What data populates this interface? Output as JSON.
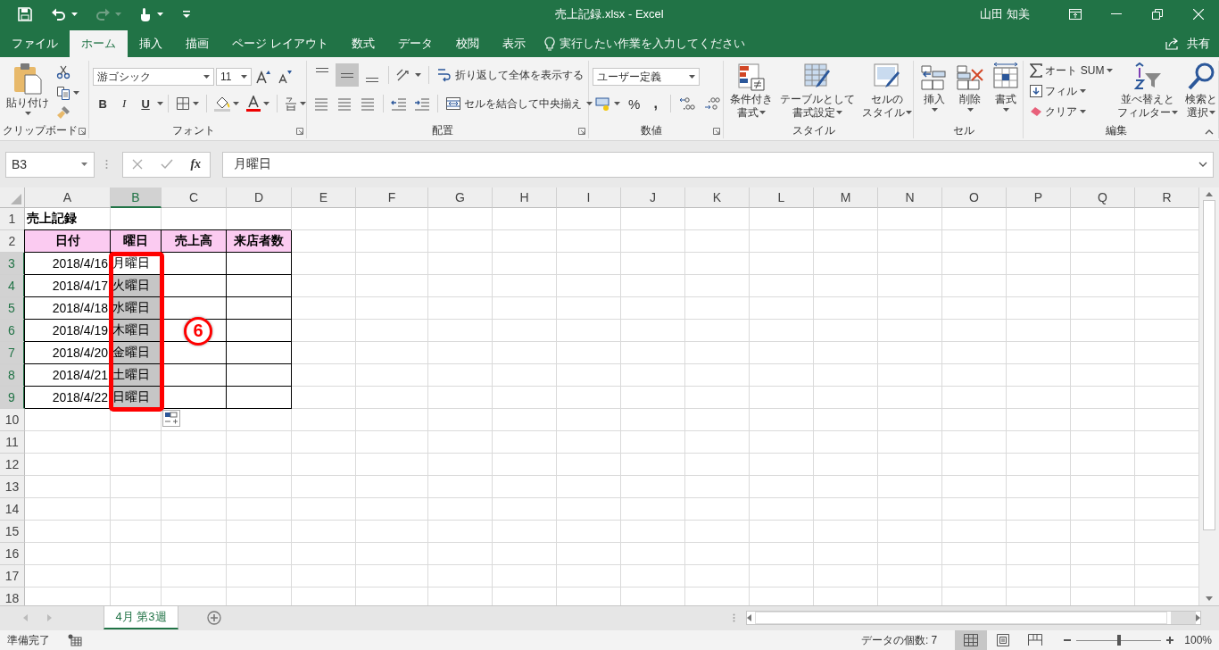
{
  "title_bar": {
    "title": "売上記録.xlsx  -  Excel",
    "user": "山田 知美",
    "redo_disabled": true
  },
  "ribbon_tabs": [
    {
      "label": "ファイル",
      "selected": false
    },
    {
      "label": "ホーム",
      "selected": true
    },
    {
      "label": "挿入",
      "selected": false
    },
    {
      "label": "描画",
      "selected": false
    },
    {
      "label": "ページ レイアウト",
      "selected": false
    },
    {
      "label": "数式",
      "selected": false
    },
    {
      "label": "データ",
      "selected": false
    },
    {
      "label": "校閲",
      "selected": false
    },
    {
      "label": "表示",
      "selected": false
    }
  ],
  "tell_me": {
    "placeholder": "実行したい作業を入力してください"
  },
  "share": "共有",
  "ribbon": {
    "groups": [
      {
        "kind": "clipboard",
        "label": "クリップボード",
        "paste": "貼り付け"
      },
      {
        "kind": "font",
        "label": "フォント",
        "font_name": "游ゴシック",
        "font_size": "11",
        "bold": "B",
        "italic": "I",
        "underline": "U"
      },
      {
        "kind": "alignment",
        "label": "配置",
        "vertical_align": [
          {
            "selected": false
          },
          {
            "selected": true
          },
          {
            "selected": false
          }
        ],
        "wrap_text": "折り返して全体を表示する",
        "merge_center": "セルを結合して中央揃え"
      },
      {
        "kind": "number",
        "label": "数値",
        "format": "ユーザー定義",
        "percent": "%",
        "comma": ","
      },
      {
        "kind": "styles",
        "label": "スタイル",
        "buttons": [
          {
            "lines": [
              "条件付き",
              "書式"
            ]
          },
          {
            "lines": [
              "テーブルとして",
              "書式設定"
            ]
          },
          {
            "lines": [
              "セルの",
              "スタイル"
            ]
          }
        ]
      },
      {
        "kind": "cells",
        "label": "セル",
        "buttons": [
          {
            "lines": [
              "挿入"
            ]
          },
          {
            "lines": [
              "削除"
            ]
          },
          {
            "lines": [
              "書式"
            ]
          }
        ]
      },
      {
        "kind": "editing",
        "label": "編集",
        "autosum": "オート SUM",
        "fill": "フィル",
        "clear": "クリア",
        "buttons": [
          {
            "lines": [
              "並べ替えと",
              "フィルター"
            ]
          },
          {
            "lines": [
              "検索と",
              "選択"
            ]
          }
        ]
      }
    ]
  },
  "formula_bar": {
    "name_box": "B3",
    "fx": "fx",
    "value": "月曜日"
  },
  "sheet": {
    "columns": [
      {
        "label": "A",
        "selected": false
      },
      {
        "label": "B",
        "selected": true
      },
      {
        "label": "C",
        "selected": false
      },
      {
        "label": "D",
        "selected": false
      },
      {
        "label": "E",
        "selected": false
      },
      {
        "label": "F",
        "selected": false
      },
      {
        "label": "G",
        "selected": false
      },
      {
        "label": "H",
        "selected": false
      },
      {
        "label": "I",
        "selected": false
      },
      {
        "label": "J",
        "selected": false
      },
      {
        "label": "K",
        "selected": false
      },
      {
        "label": "L",
        "selected": false
      },
      {
        "label": "M",
        "selected": false
      },
      {
        "label": "N",
        "selected": false
      },
      {
        "label": "O",
        "selected": false
      },
      {
        "label": "P",
        "selected": false
      },
      {
        "label": "Q",
        "selected": false
      },
      {
        "label": "R",
        "selected": false
      }
    ],
    "rows": [
      {
        "label": "1",
        "selected": false,
        "cells": [
          {
            "kind": "title",
            "text": "売上記録"
          }
        ]
      },
      {
        "label": "2",
        "selected": false,
        "cells": [
          {
            "kind": "header",
            "text": "日付"
          },
          {
            "kind": "header",
            "text": "曜日"
          },
          {
            "kind": "header",
            "text": "売上高"
          },
          {
            "kind": "header",
            "text": "来店者数"
          }
        ]
      },
      {
        "label": "3",
        "selected": true,
        "cells": [
          {
            "kind": "date",
            "text": "2018/4/16"
          },
          {
            "kind": "day",
            "text": "月曜日",
            "selected": true,
            "active": true
          },
          {
            "kind": "blank"
          },
          {
            "kind": "blank"
          }
        ]
      },
      {
        "label": "4",
        "selected": true,
        "cells": [
          {
            "kind": "date",
            "text": "2018/4/17"
          },
          {
            "kind": "day",
            "text": "火曜日",
            "selected": true,
            "active": false
          },
          {
            "kind": "blank"
          },
          {
            "kind": "blank"
          }
        ]
      },
      {
        "label": "5",
        "selected": true,
        "cells": [
          {
            "kind": "date",
            "text": "2018/4/18"
          },
          {
            "kind": "day",
            "text": "水曜日",
            "selected": true,
            "active": false
          },
          {
            "kind": "blank"
          },
          {
            "kind": "blank"
          }
        ]
      },
      {
        "label": "6",
        "selected": true,
        "cells": [
          {
            "kind": "date",
            "text": "2018/4/19"
          },
          {
            "kind": "day",
            "text": "木曜日",
            "selected": true,
            "active": false
          },
          {
            "kind": "blank"
          },
          {
            "kind": "blank"
          }
        ]
      },
      {
        "label": "7",
        "selected": true,
        "cells": [
          {
            "kind": "date",
            "text": "2018/4/20"
          },
          {
            "kind": "day",
            "text": "金曜日",
            "selected": true,
            "active": false
          },
          {
            "kind": "blank"
          },
          {
            "kind": "blank"
          }
        ]
      },
      {
        "label": "8",
        "selected": true,
        "cells": [
          {
            "kind": "date",
            "text": "2018/4/21"
          },
          {
            "kind": "day",
            "text": "土曜日",
            "selected": true,
            "active": false
          },
          {
            "kind": "blank"
          },
          {
            "kind": "blank"
          }
        ]
      },
      {
        "label": "9",
        "selected": true,
        "cells": [
          {
            "kind": "date",
            "text": "2018/4/22"
          },
          {
            "kind": "day",
            "text": "日曜日",
            "selected": true,
            "active": false
          },
          {
            "kind": "blank"
          },
          {
            "kind": "blank"
          }
        ]
      },
      {
        "label": "10",
        "selected": false
      },
      {
        "label": "11",
        "selected": false
      },
      {
        "label": "12",
        "selected": false
      },
      {
        "label": "13",
        "selected": false
      },
      {
        "label": "14",
        "selected": false
      },
      {
        "label": "15",
        "selected": false
      },
      {
        "label": "16",
        "selected": false
      },
      {
        "label": "17",
        "selected": false
      },
      {
        "label": "18",
        "selected": false
      }
    ],
    "callout": {
      "label": "6"
    }
  },
  "sheet_tabs": [
    {
      "label": "4月 第3週",
      "selected": true
    }
  ],
  "status_bar": {
    "status": "準備完了",
    "count": "データの個数: 7",
    "views": [
      {
        "kind": "normal",
        "selected": true
      },
      {
        "kind": "page_layout",
        "selected": false
      },
      {
        "kind": "page_break",
        "selected": false
      }
    ],
    "zoom": {
      "level": 0.5,
      "reading": "100%"
    }
  }
}
